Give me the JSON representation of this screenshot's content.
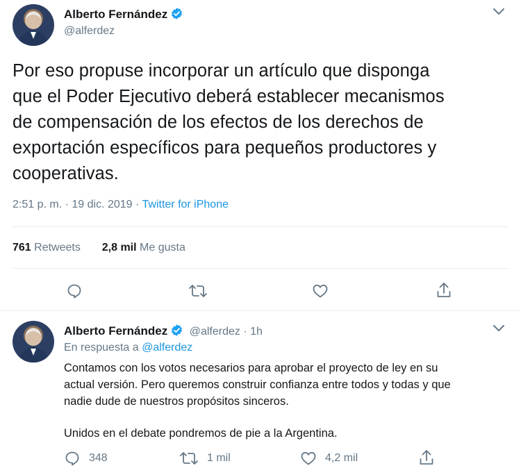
{
  "main_tweet": {
    "author_name": "Alberto Fernández",
    "author_handle": "@alferdez",
    "text_lines": [
      "Por eso propuse incorporar un artículo que disponga",
      "que el Poder Ejecutivo deberá establecer mecanismos",
      "de compensación de los efectos de los derechos de",
      "exportación específicos para pequeños productores y",
      "cooperativas."
    ],
    "time": "2:51 p. m.",
    "separator": " · ",
    "date": "19 dic. 2019",
    "source": "Twitter for iPhone",
    "retweets_count": "761",
    "retweets_label": "Retweets",
    "likes_count": "2,8 mil",
    "likes_label": "Me gusta",
    "icons": [
      "reply-icon",
      "retweet-icon",
      "like-icon",
      "share-icon"
    ]
  },
  "reply_tweet": {
    "author_name": "Alberto Fernández",
    "author_handle": "@alferdez",
    "time_ago": "· 1h",
    "in_reply_prefix": "En respuesta a",
    "in_reply_handle": "@alferdez",
    "text_lines": [
      "Contamos con los votos necesarios para aprobar el proyecto de ley en su",
      "actual versión. Pero queremos construir confianza entre todos y todas y que",
      "nadie dude de nuestros propósitos sinceros."
    ],
    "text_line_2": "Unidos en el debate pondremos de pie a la Argentina.",
    "replies_count": "348",
    "retweets_count": "1 mil",
    "likes_count": "4,2 mil"
  },
  "colors": {
    "text": "#14171a",
    "secondary": "#657786",
    "link": "#1b95e0",
    "verified": "#1da1f2",
    "divider": "#e6ecf0"
  }
}
